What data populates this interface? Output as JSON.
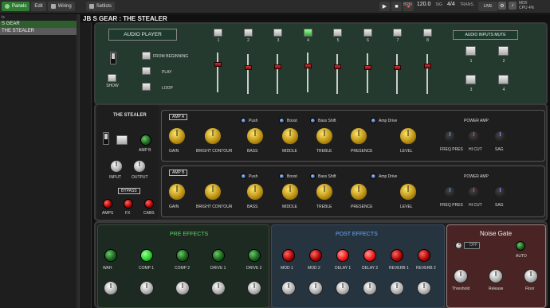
{
  "topbar": {
    "tabs": [
      {
        "label": "Panels",
        "active": true
      },
      {
        "label": "Edit",
        "active": false
      },
      {
        "label": "Wiring",
        "active": false
      },
      {
        "label": "Setlists",
        "active": false
      }
    ],
    "bpm_label": "BPM",
    "bpm_value": "120.0",
    "sig_label": "SIG",
    "sig_value": "4/4",
    "trans_label": "TRANS.",
    "trans_value": "0",
    "live_label": "LIVE",
    "midi_label": "MIDI",
    "cpu_label": "CPU",
    "cpu_value": "4%"
  },
  "sidebar": {
    "header": "ts",
    "items": [
      {
        "label": "S GEAR",
        "selected": false
      },
      {
        "label": "THE STEALER",
        "selected": true
      }
    ]
  },
  "page_title": "JB S GEAR : THE STEALER",
  "audio_player": {
    "title": "AUDIO PLAYER",
    "from_beginning": "FROM BEGINNING",
    "play": "PLAY",
    "loop": "LOOP",
    "show": "SHOW",
    "channels": [
      "1",
      "2",
      "3",
      "4",
      "5",
      "6",
      "7",
      "8"
    ],
    "lit_channel": 4
  },
  "inputs_mute": {
    "title": "AUDIO INPUTS MUTE",
    "buttons": [
      "1",
      "2",
      "3",
      "4"
    ]
  },
  "stealer": {
    "title": "THE STEALER",
    "amp_b": "AMP B",
    "input": "INPUT",
    "output": "OUTPUT",
    "bypass": "BYPASS",
    "amps": "AMPS",
    "fx": "FX",
    "cabs": "CABS"
  },
  "amps": [
    {
      "name": "AMP A",
      "switches": [
        "Push",
        "Boost",
        "Bass Shift",
        "Amp Drive"
      ],
      "knobs": [
        "GAIN",
        "BRIGHT CONTOUR",
        "BASS",
        "MIDDLE",
        "TREBLE",
        "PRESENCE",
        "LEVEL"
      ],
      "power_amp": "POWER AMP",
      "power_knobs": [
        "FREQ PRES",
        "HI CUT",
        "SAG"
      ]
    },
    {
      "name": "AMP B",
      "switches": [
        "Push",
        "Boost",
        "Bass Shift",
        "Amp Drive"
      ],
      "knobs": [
        "GAIN",
        "BRIGHT CONTOUR",
        "BASS",
        "MIDDLE",
        "TREBLE",
        "PRESENCE",
        "LEVEL"
      ],
      "power_amp": "POWER AMP",
      "power_knobs": [
        "FREQ PRES",
        "HI CUT",
        "SAG"
      ]
    }
  ],
  "pre_effects": {
    "title": "PRE EFFECTS",
    "title_color": "#5fd35f",
    "items": [
      {
        "label": "WAH",
        "on": false
      },
      {
        "label": "COMP 1",
        "on": true
      },
      {
        "label": "COMP 2",
        "on": false
      },
      {
        "label": "DRIVE 1",
        "on": false
      },
      {
        "label": "DRIVE 2",
        "on": false
      }
    ]
  },
  "post_effects": {
    "title": "POST EFFECTS",
    "title_color": "#6aa8ff",
    "items": [
      {
        "label": "MOD 1",
        "on": false
      },
      {
        "label": "MOD 2",
        "on": false
      },
      {
        "label": "DELAY 1",
        "on": true
      },
      {
        "label": "DELAY 2",
        "on": true
      },
      {
        "label": "REVERB 1",
        "on": false
      },
      {
        "label": "REVERB 2",
        "on": false
      }
    ]
  },
  "noise_gate": {
    "title": "Noise Gate",
    "switch": "OFF",
    "auto": "AUTO",
    "knobs": [
      "Threshold",
      "Release",
      "Floor"
    ]
  }
}
